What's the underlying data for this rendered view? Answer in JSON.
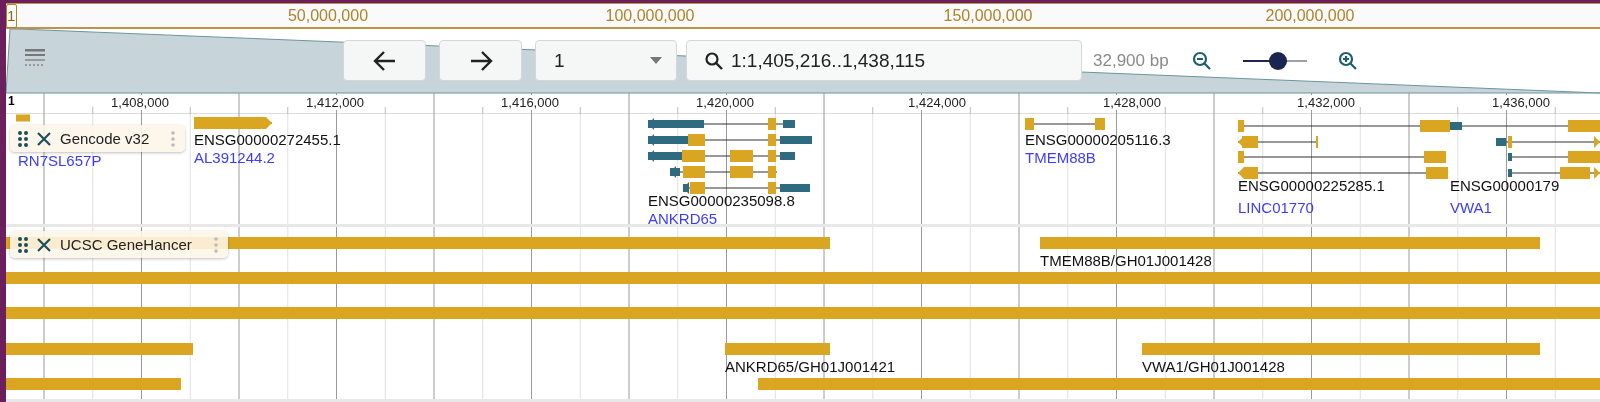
{
  "overview": {
    "chromosome": "1",
    "ticks": [
      "50,000,000",
      "100,000,000",
      "150,000,000",
      "200,000,000"
    ]
  },
  "toolbar": {
    "region_select": "1",
    "location": "1:1,405,216..1,438,115",
    "span": "32,900 bp",
    "zoom": {
      "level": 0.55
    }
  },
  "ruler": {
    "chromosome": "1",
    "ticks": [
      "1,408,000",
      "1,412,000",
      "1,416,000",
      "1,420,000",
      "1,424,000",
      "1,428,000",
      "1,432,000",
      "1,436,000"
    ]
  },
  "tracks": [
    {
      "kind": "genes",
      "title": "Gencode v32",
      "features": [
        {
          "gene": "RN7SL657P"
        },
        {
          "id_label": "ENSG00000272455.1",
          "gene": "AL391244.2"
        },
        {
          "id_label": "ENSG00000235098.8",
          "gene": "ANKRD65"
        },
        {
          "id_label": "ENSG00000205116.3",
          "gene": "TMEM88B"
        },
        {
          "id_label": "ENSG00000225285.1",
          "gene": "LINC01770"
        },
        {
          "id_label": "ENSG00000179",
          "gene": "VWA1"
        }
      ]
    },
    {
      "kind": "regions",
      "title": "UCSC GeneHancer",
      "labels": [
        "TMEM88B/GH01J001428",
        "ANKRD65/GH01J001421",
        "VWA1/GH01J001428"
      ]
    }
  ]
}
